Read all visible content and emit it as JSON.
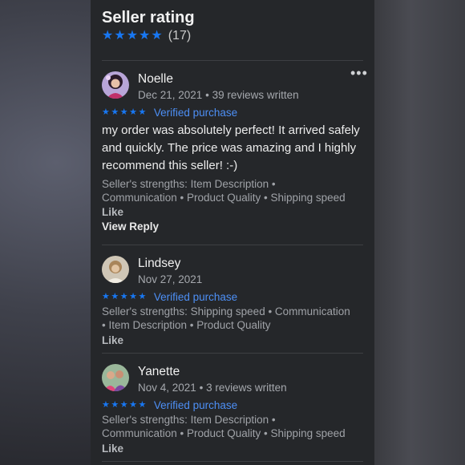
{
  "header": {
    "title": "Seller rating",
    "stars": 5,
    "count": "(17)"
  },
  "colors": {
    "star": "#1877f2",
    "verified": "#4d8ff5",
    "panel_bg": "#25272a"
  },
  "icons": {
    "star": "star-icon",
    "more": "more-options-icon"
  },
  "reviews": [
    {
      "name": "Noelle",
      "date": "Dec 21, 2021",
      "reviews_written": "39 reviews written",
      "stars": 5,
      "verified": "Verified purchase",
      "text": "my order was absolutely perfect! It arrived safely and quickly. The price was amazing and I highly recommend this seller! :-)",
      "strengths_line1": "Seller's strengths: Item Description •",
      "strengths_line2": "Communication • Product Quality • Shipping speed",
      "like": "Like",
      "reply": "View Reply",
      "more": "•••"
    },
    {
      "name": "Lindsey",
      "date": "Nov 27, 2021",
      "stars": 5,
      "verified": "Verified purchase",
      "strengths_line1": "Seller's strengths: Shipping speed • Communication",
      "strengths_line2": "• Item Description • Product Quality",
      "like": "Like"
    },
    {
      "name": "Yanette",
      "date": "Nov 4, 2021",
      "reviews_written": "3 reviews written",
      "stars": 5,
      "verified": "Verified purchase",
      "strengths_line1": "Seller's strengths: Item Description •",
      "strengths_line2": "Communication • Product Quality • Shipping speed",
      "like": "Like"
    }
  ]
}
